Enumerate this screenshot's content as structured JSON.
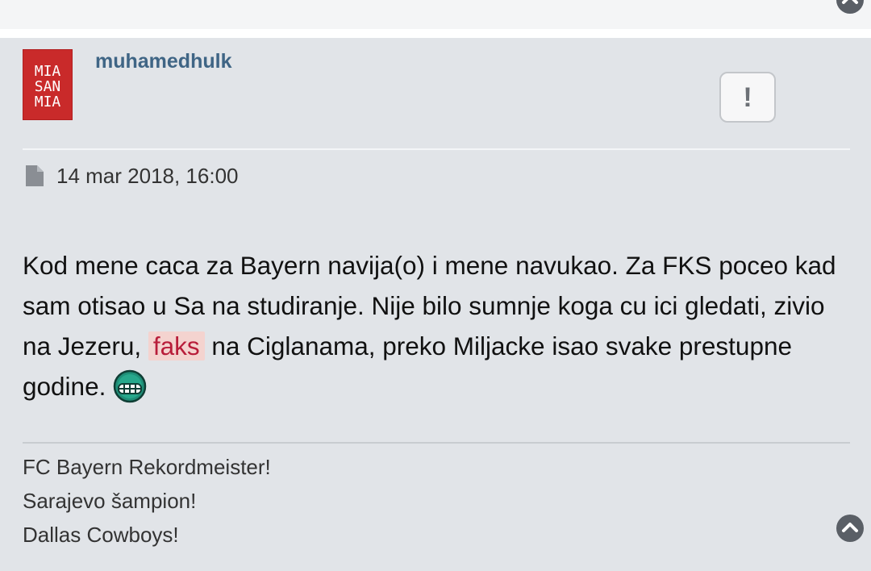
{
  "post": {
    "author": "muhamedhulk",
    "avatar_text": [
      "MIA",
      "SAN",
      "MIA"
    ],
    "report_label": "!",
    "date": "14 mar 2018, 16:00",
    "body": {
      "part1": "Kod mene caca za Bayern navija(o) i mene navukao. Za FKS poceo kad sam otisao u Sa na studiranje. Nije bilo sumnje koga cu ici gledati, zivio na Jezeru, ",
      "highlight": "faks",
      "part2": " na Ciglanama, preko Miljacke isao svake prestupne godine. "
    },
    "signature": [
      "FC Bayern Rekordmeister!",
      "Sarajevo šampion!",
      "Dallas Cowboys!"
    ]
  },
  "icons": {
    "back_to_top": "chevron-up-circle-icon",
    "date": "file-icon",
    "smiley": "grin-smiley-icon"
  },
  "colors": {
    "post_bg": "#e1e4e8",
    "username": "#3f6585",
    "avatar_bg": "#c92a2a",
    "highlight_bg": "#f4d3cf",
    "highlight_text": "#b81d3a"
  }
}
